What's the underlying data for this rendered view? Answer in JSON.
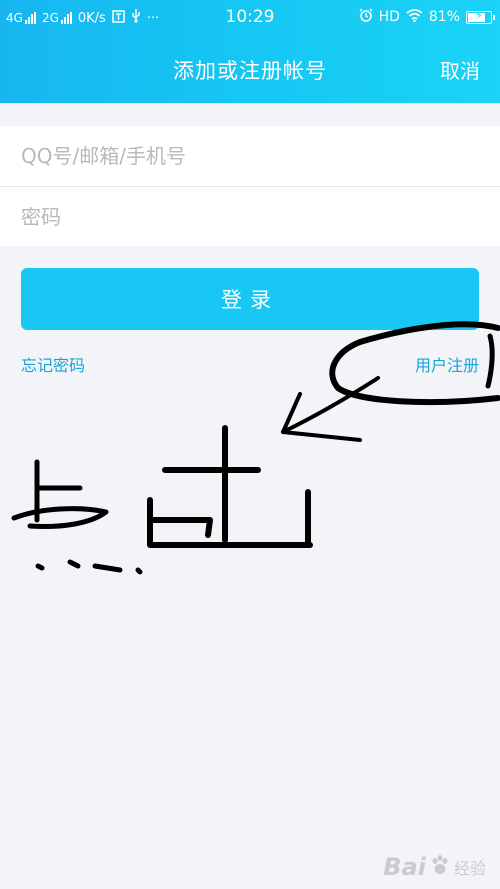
{
  "status_bar": {
    "sim1": "4G",
    "sim2": "2G",
    "speed": "0K/s",
    "dots": "···",
    "time": "10:29",
    "hd": "HD",
    "battery": "81%",
    "battery_level": 0.81
  },
  "nav": {
    "title": "添加或注册帐号",
    "cancel": "取消"
  },
  "form": {
    "account_placeholder": "QQ号/邮箱/手机号",
    "password_placeholder": "密码"
  },
  "login_button": "登录",
  "links": {
    "forgot": "忘记密码",
    "register": "用户注册"
  },
  "watermark": {
    "brand": "Bai",
    "text": "经验"
  },
  "colors": {
    "header": "#17b6f1",
    "button": "#19c7f5",
    "link": "#1aa3d9",
    "background": "#f3f4f8"
  },
  "icons": [
    "usb-icon",
    "alarm-icon",
    "wifi-icon",
    "battery-icon"
  ]
}
